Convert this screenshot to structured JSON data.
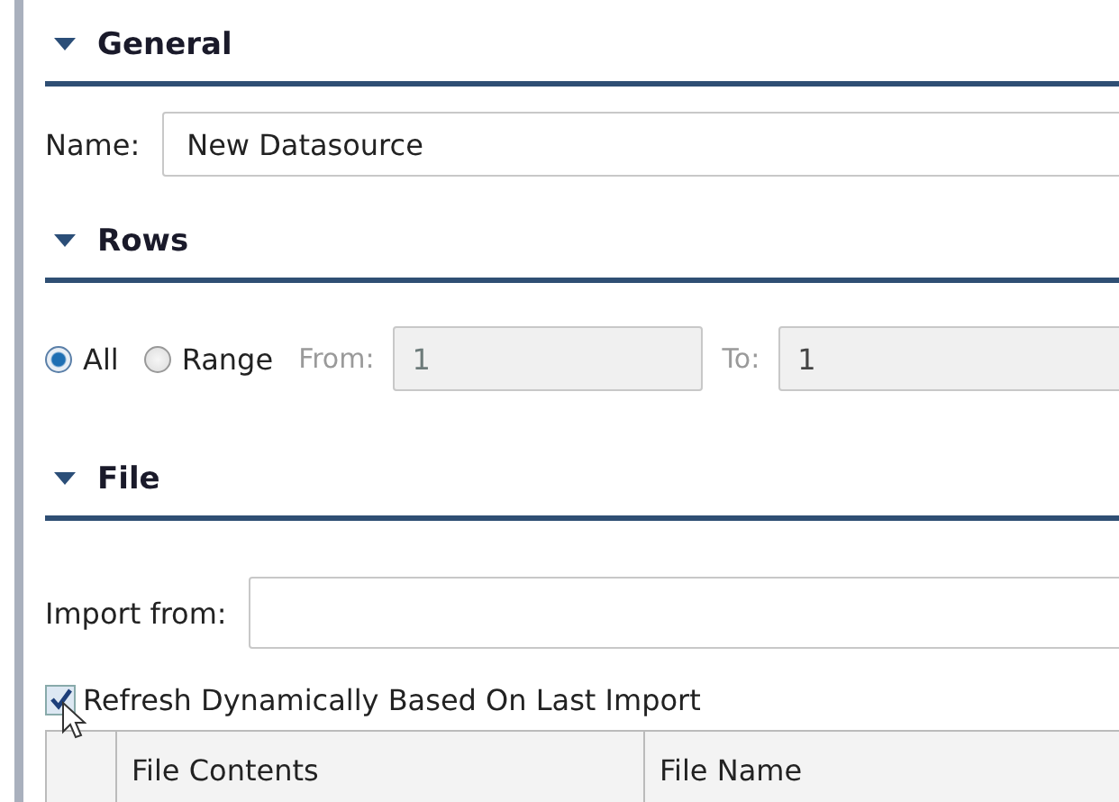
{
  "sections": [
    {
      "kind": "general",
      "title": "General",
      "expanded": true,
      "name_label": "Name:",
      "name_value": "New Datasource"
    },
    {
      "kind": "rows",
      "title": "Rows",
      "expanded": true,
      "options": [
        {
          "label": "All",
          "selected": true
        },
        {
          "label": "Range",
          "selected": false
        }
      ],
      "from": {
        "label": "From:",
        "value": "1",
        "disabled": true
      },
      "to": {
        "label": "To:",
        "value": "1",
        "disabled": true
      }
    },
    {
      "kind": "file",
      "title": "File",
      "expanded": true,
      "import_label": "Import from:",
      "refresh": {
        "label": "Refresh Dynamically Based On Last Import",
        "checked": true
      },
      "table": {
        "columns": [
          "File Contents",
          "File Name"
        ]
      }
    }
  ]
}
